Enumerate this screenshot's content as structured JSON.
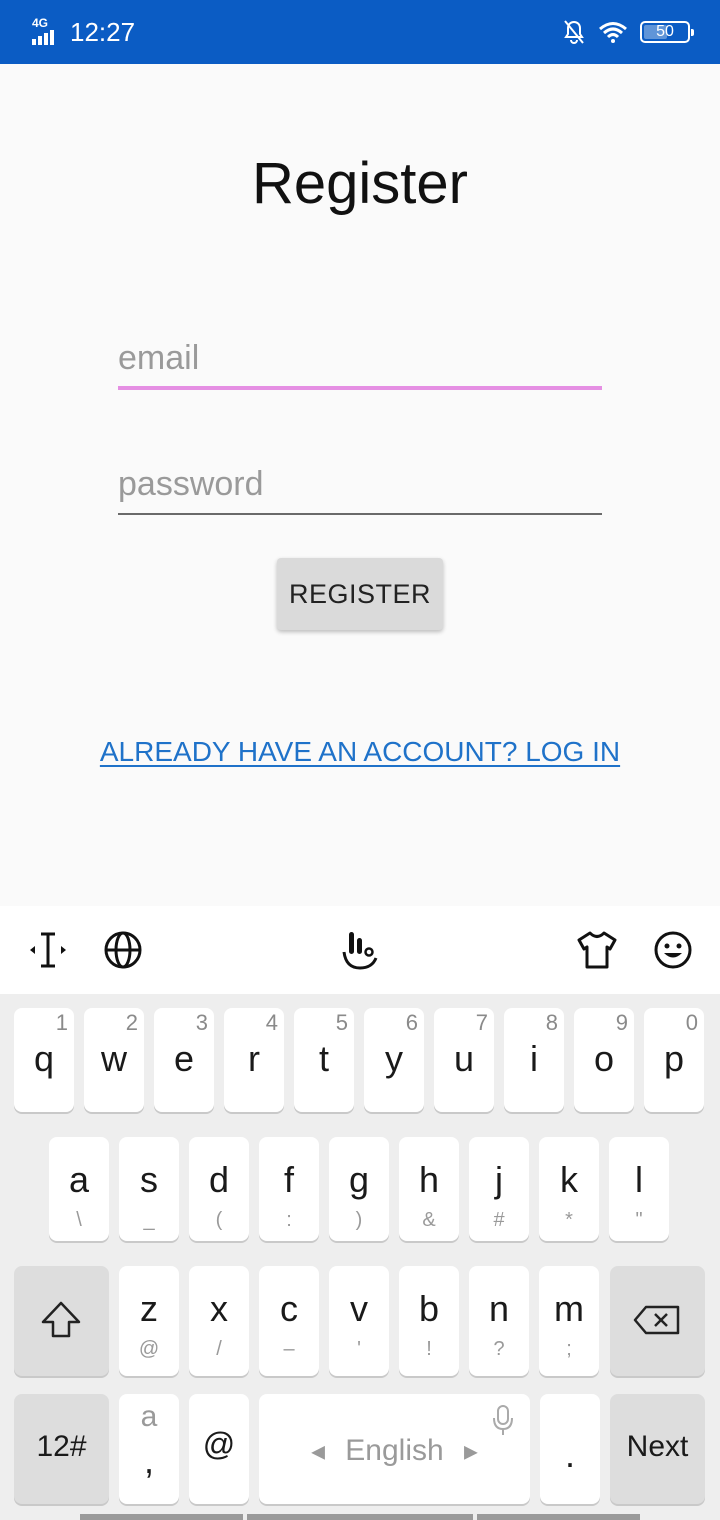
{
  "status_bar": {
    "network": "4G",
    "time": "12:27",
    "battery_level": "50",
    "icons": [
      "signal-icon",
      "notifications-off-icon",
      "wifi-icon",
      "battery-icon"
    ]
  },
  "page": {
    "title": "Register",
    "email_placeholder": "email",
    "password_placeholder": "password",
    "register_button": "REGISTER",
    "login_link": "ALREADY HAVE AN ACCOUNT? LOG IN",
    "colors": {
      "status_bar": "#0b5cc4",
      "focus_underline": "#e58fe3",
      "link": "#1f72c9",
      "button_bg": "#dadada"
    }
  },
  "keyboard": {
    "toolbar_icons": [
      "text-cursor-icon",
      "globe-icon",
      "touchpal-logo-icon",
      "theme-shirt-icon",
      "emoji-smiley-icon"
    ],
    "row1": [
      {
        "key": "q",
        "hint": "1"
      },
      {
        "key": "w",
        "hint": "2"
      },
      {
        "key": "e",
        "hint": "3"
      },
      {
        "key": "r",
        "hint": "4"
      },
      {
        "key": "t",
        "hint": "5"
      },
      {
        "key": "y",
        "hint": "6"
      },
      {
        "key": "u",
        "hint": "7"
      },
      {
        "key": "i",
        "hint": "8"
      },
      {
        "key": "o",
        "hint": "9"
      },
      {
        "key": "p",
        "hint": "0"
      }
    ],
    "row2": [
      {
        "key": "a",
        "sub": "\\"
      },
      {
        "key": "s",
        "sub": "_"
      },
      {
        "key": "d",
        "sub": "("
      },
      {
        "key": "f",
        "sub": ":"
      },
      {
        "key": "g",
        "sub": ")"
      },
      {
        "key": "h",
        "sub": "&"
      },
      {
        "key": "j",
        "sub": "#"
      },
      {
        "key": "k",
        "sub": "*"
      },
      {
        "key": "l",
        "sub": "\""
      }
    ],
    "row3": [
      {
        "key": "z",
        "sub": "@"
      },
      {
        "key": "x",
        "sub": "/"
      },
      {
        "key": "c",
        "sub": "–"
      },
      {
        "key": "v",
        "sub": "'"
      },
      {
        "key": "b",
        "sub": "!"
      },
      {
        "key": "n",
        "sub": "?"
      },
      {
        "key": "m",
        "sub": ";"
      }
    ],
    "row4": {
      "symbols": "12#",
      "comma_top": "a",
      "comma": ",",
      "at": "@",
      "space": "English",
      "period": ".",
      "next": "Next"
    }
  }
}
